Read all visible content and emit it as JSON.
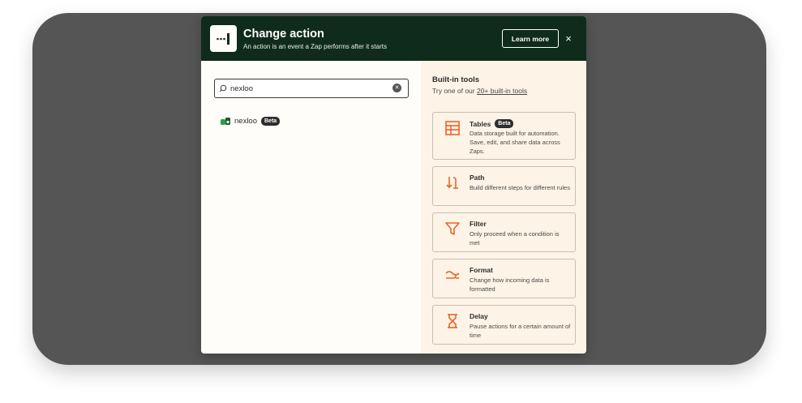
{
  "header": {
    "title": "Change action",
    "subtitle": "An action is an event a Zap performs after it starts",
    "learn_more": "Learn more",
    "close": "×",
    "logo_icon": "zap-logo-icon"
  },
  "search": {
    "value": "nexloo",
    "clear_icon": "clear-icon"
  },
  "results": [
    {
      "name": "nexloo",
      "badge": "Beta"
    }
  ],
  "builtin": {
    "title": "Built-in tools",
    "sub_prefix": "Try one of our ",
    "sub_link": "20+ built-in tools",
    "tools": [
      {
        "name": "Tables",
        "badge": "Beta",
        "desc": "Data storage built for automation. Save, edit, and share data across Zaps.",
        "icon": "table-icon"
      },
      {
        "name": "Path",
        "desc": "Build different steps for different rules",
        "icon": "path-icon"
      },
      {
        "name": "Filter",
        "desc": "Only proceed when a condition is met",
        "icon": "filter-icon"
      },
      {
        "name": "Format",
        "desc": "Change how incoming data is formatted",
        "icon": "format-icon"
      },
      {
        "name": "Delay",
        "desc": "Pause actions for a certain amount of time",
        "icon": "hourglass-icon"
      }
    ]
  },
  "colors": {
    "header_bg": "#0f2b1c",
    "accent_orange": "#e8652a",
    "panel_right": "#fdf3e6"
  }
}
